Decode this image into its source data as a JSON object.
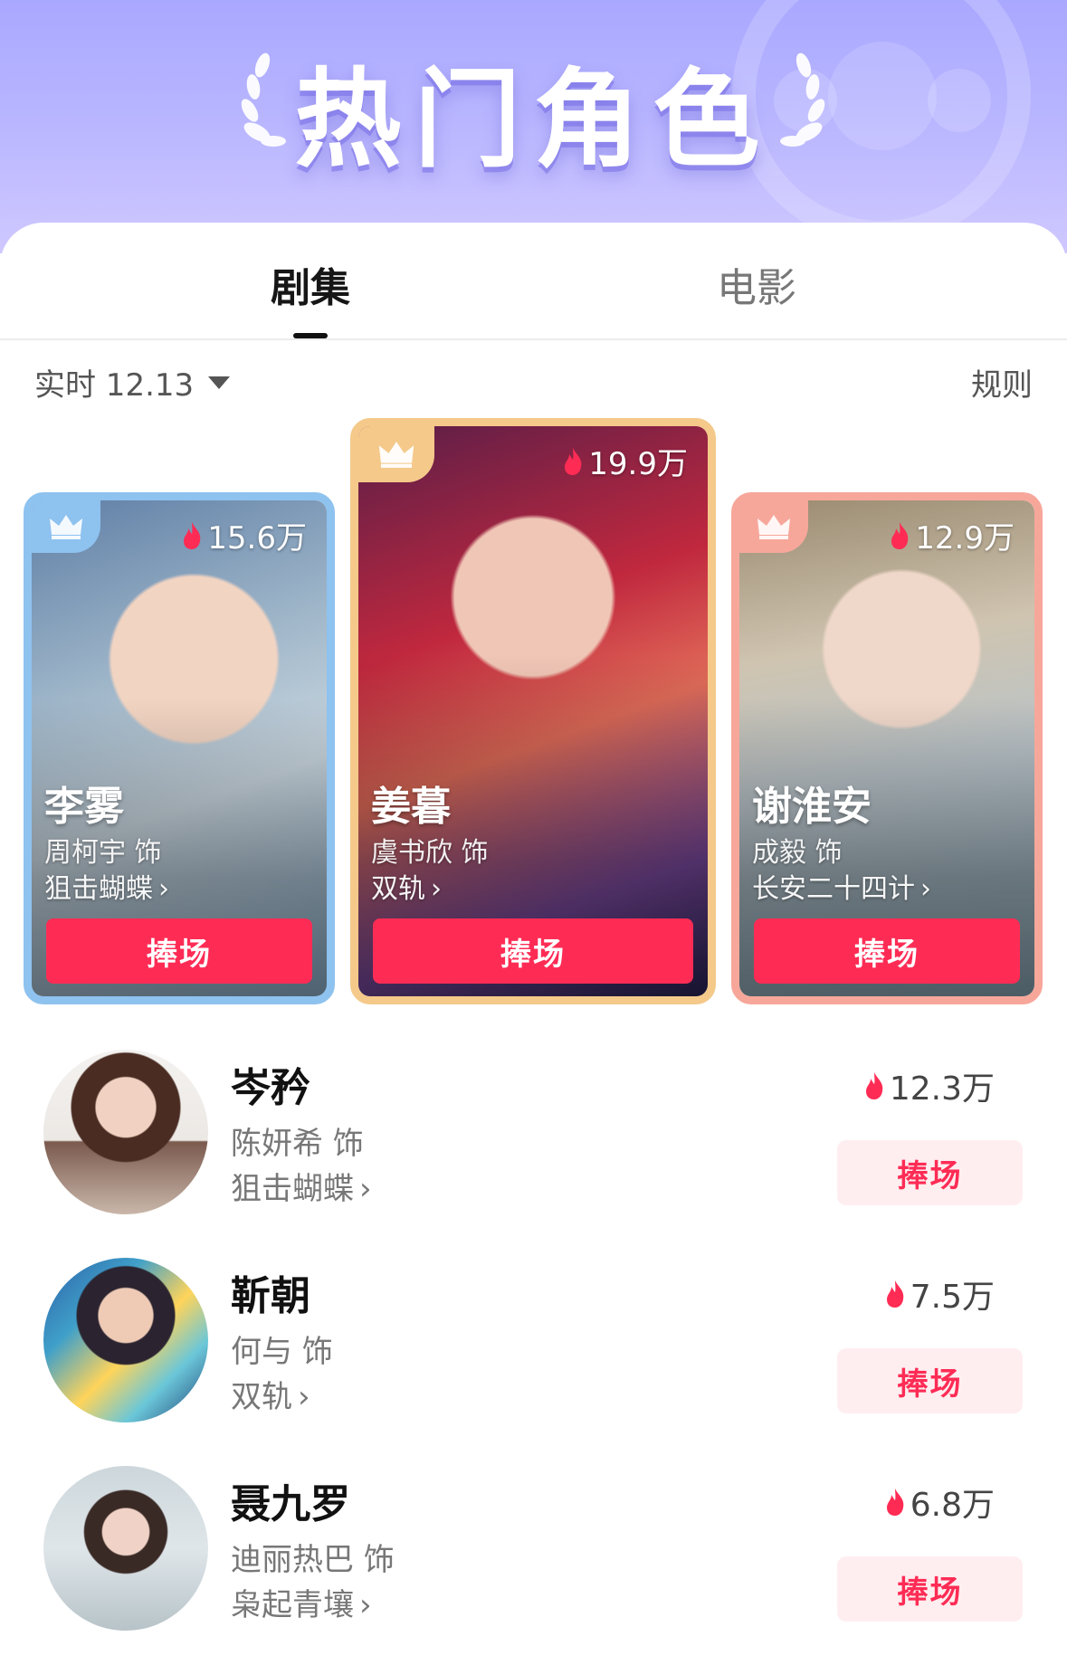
{
  "banner": {
    "title": "热门角色"
  },
  "tabs": [
    {
      "label": "剧集",
      "active": true
    },
    {
      "label": "电影",
      "active": false
    }
  ],
  "filter": {
    "date_label": "实时 12.13",
    "rules_label": "规则"
  },
  "top3": [
    {
      "name": "李雾",
      "actor": "周柯宇 饰",
      "show": "狙击蝴蝶",
      "heat": "15.6万",
      "button": "捧场"
    },
    {
      "name": "姜暮",
      "actor": "虞书欣 饰",
      "show": "双轨",
      "heat": "19.9万",
      "button": "捧场"
    },
    {
      "name": "谢淮安",
      "actor": "成毅 饰",
      "show": "长安二十四计",
      "heat": "12.9万",
      "button": "捧场"
    }
  ],
  "list": [
    {
      "name": "岑矜",
      "actor": "陈妍希  饰",
      "show": "狙击蝴蝶",
      "heat": "12.3万",
      "button": "捧场"
    },
    {
      "name": "靳朝",
      "actor": "何与  饰",
      "show": "双轨",
      "heat": "7.5万",
      "button": "捧场"
    },
    {
      "name": "聂九罗",
      "actor": "迪丽热巴  饰",
      "show": "枭起青壤",
      "heat": "6.8万",
      "button": "捧场"
    }
  ],
  "colors": {
    "accent": "#fe2c55",
    "banner": "#b8b5ff",
    "rank1_border": "#f4c98a",
    "rank2_border": "#8ec2ef",
    "rank3_border": "#f7a79a"
  },
  "icons": [
    "laurel-icon",
    "crown-icon",
    "flame-icon",
    "chevron-right-icon",
    "caret-down-icon"
  ]
}
